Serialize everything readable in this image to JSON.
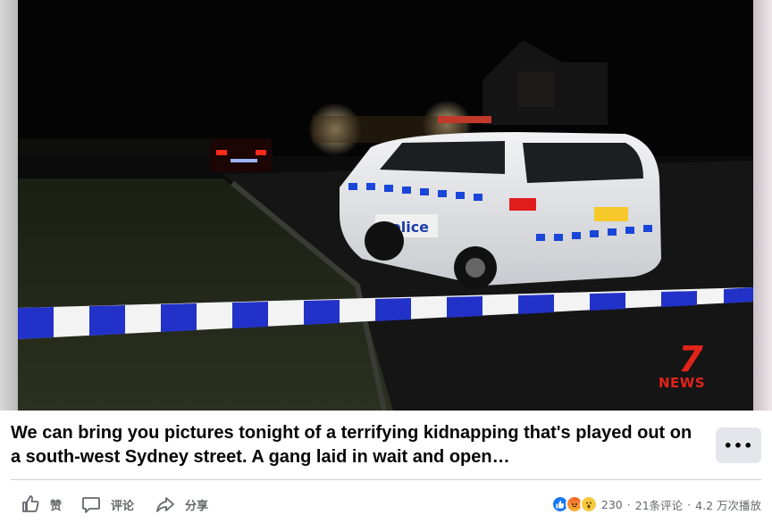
{
  "video": {
    "logo": {
      "mark": "7",
      "text": "NEWS"
    },
    "police_livery": "Police"
  },
  "post": {
    "caption": "We can bring you pictures tonight of a terrifying kidnapping that's played out on a south-west Sydney street. A gang laid in wait and open…",
    "more_label": "•••"
  },
  "actions": {
    "like_label": "赞",
    "comment_label": "评论",
    "share_label": "分享"
  },
  "stats": {
    "reaction_count": "230",
    "comments": "21条评论",
    "views": "4.2 万次播放",
    "separator": "·"
  },
  "colors": {
    "brand_blue": "#1877f2",
    "news_red": "#e2231a",
    "muted_text": "#65676b"
  }
}
